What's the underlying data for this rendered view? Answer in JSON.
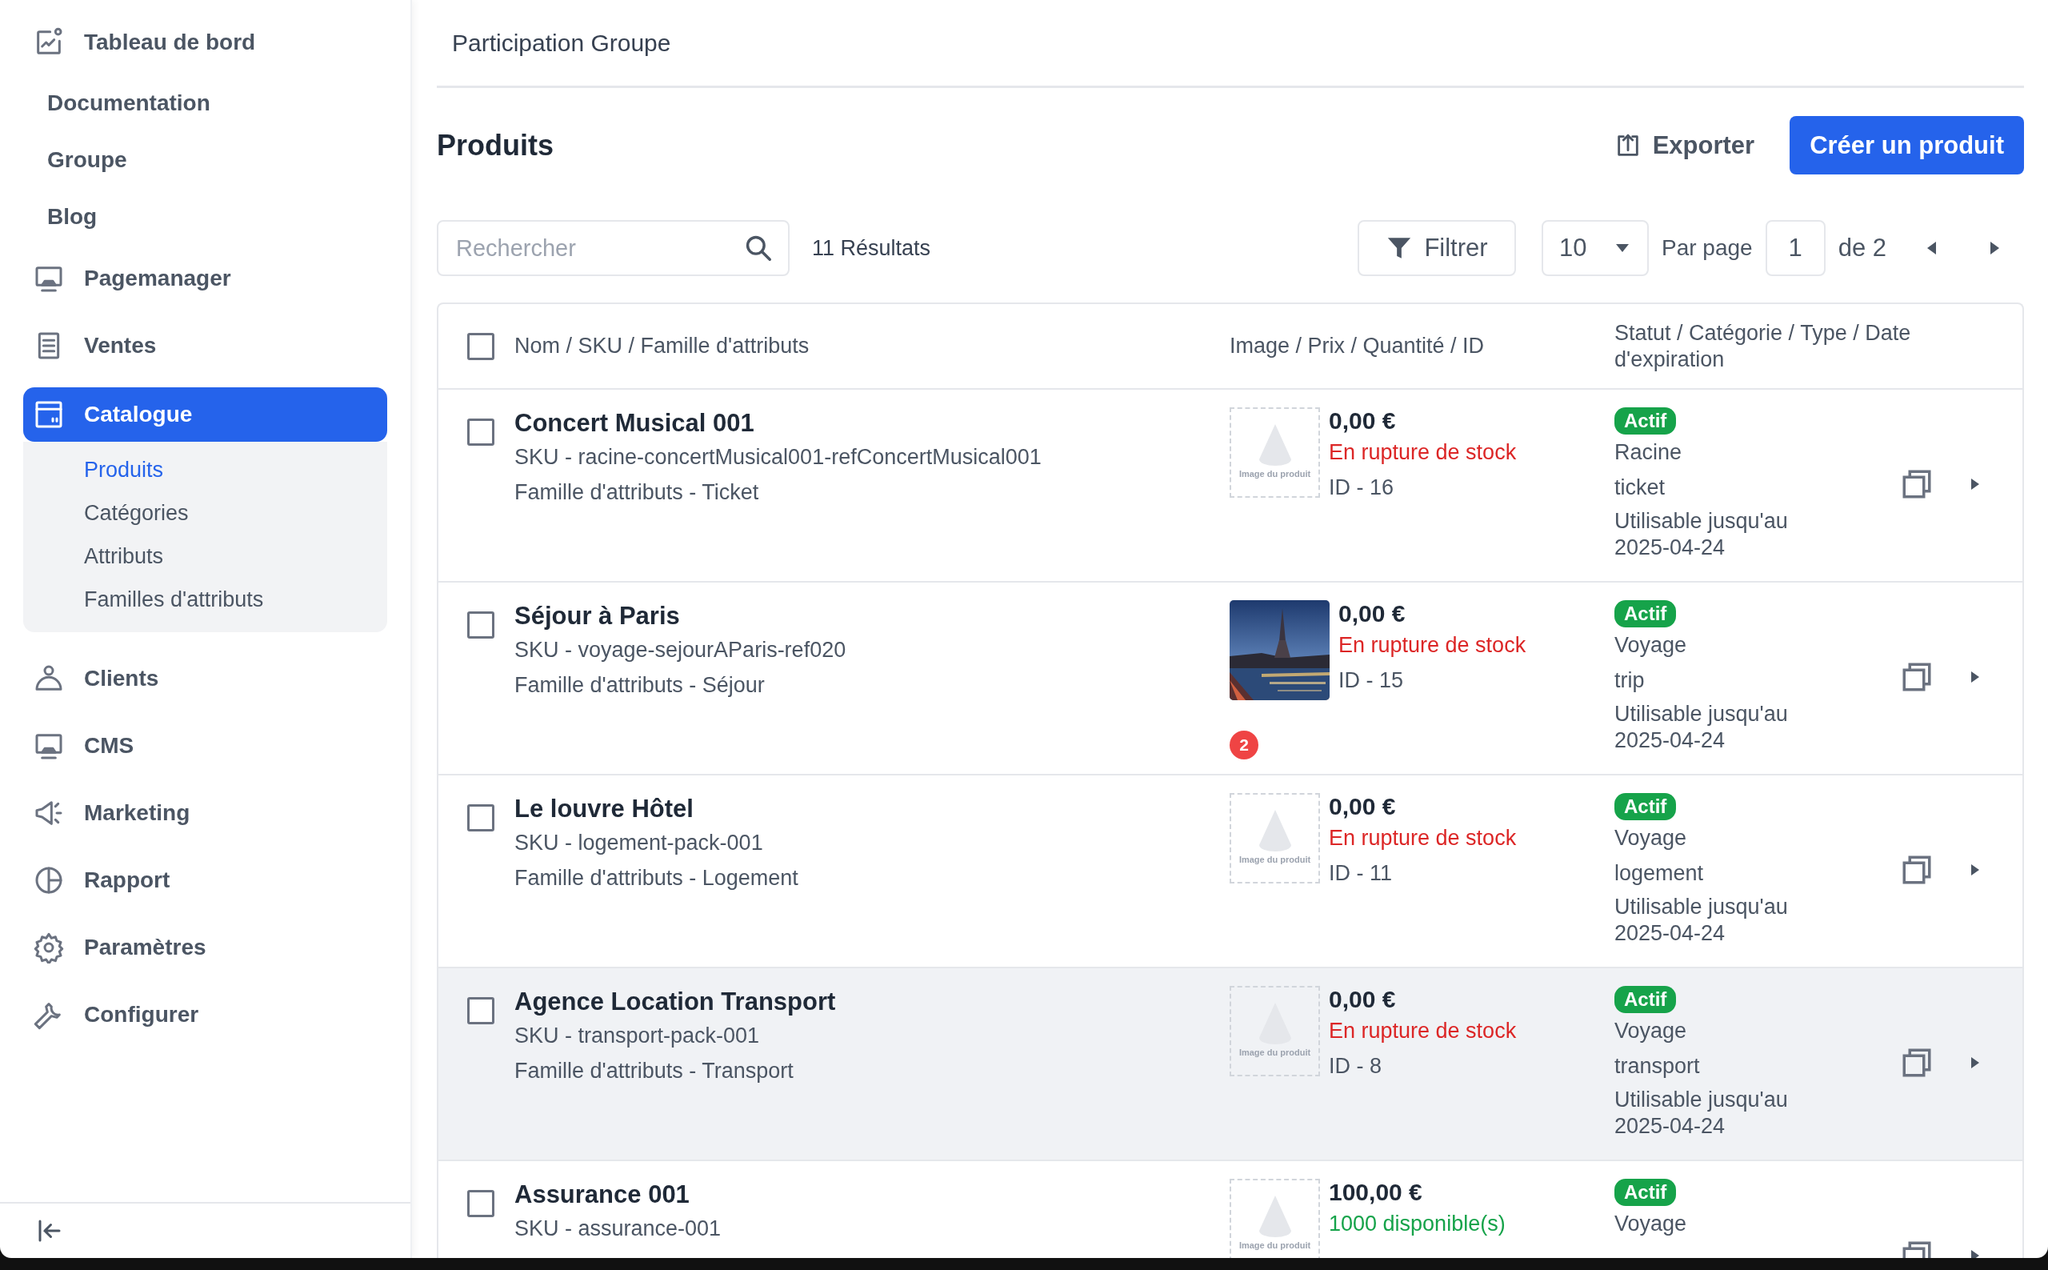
{
  "sidebar": {
    "items": [
      {
        "label": "Tableau de bord",
        "kind": "icon",
        "selected": false
      },
      {
        "label": "Documentation",
        "kind": "plain",
        "selected": false
      },
      {
        "label": "Groupe",
        "kind": "plain",
        "selected": false
      },
      {
        "label": "Blog",
        "kind": "plain",
        "selected": false
      },
      {
        "label": "Pagemanager",
        "kind": "icon",
        "selected": false
      },
      {
        "label": "Ventes",
        "kind": "icon",
        "selected": false
      },
      {
        "label": "Catalogue",
        "kind": "icon",
        "selected": true,
        "expanded": true,
        "children": [
          {
            "label": "Produits",
            "selected": true
          },
          {
            "label": "Catégories",
            "selected": false
          },
          {
            "label": "Attributs",
            "selected": false
          },
          {
            "label": "Familles d'attributs",
            "selected": false
          }
        ]
      },
      {
        "label": "Clients",
        "kind": "icon",
        "selected": false
      },
      {
        "label": "CMS",
        "kind": "icon",
        "selected": false
      },
      {
        "label": "Marketing",
        "kind": "icon",
        "selected": false
      },
      {
        "label": "Rapport",
        "kind": "icon",
        "selected": false
      },
      {
        "label": "Paramètres",
        "kind": "icon",
        "selected": false
      },
      {
        "label": "Configurer",
        "kind": "icon",
        "selected": false
      }
    ]
  },
  "header": {
    "title": "Participation Groupe"
  },
  "page": {
    "title": "Produits",
    "export_button": "Exporter",
    "create_button": "Créer un produit"
  },
  "toolbar": {
    "search": {
      "placeholder": "Rechercher"
    },
    "results": "11 Résultats",
    "filter_button": "Filtrer",
    "per_page_value": "10",
    "per_page_label": "Par page",
    "page_value": "1",
    "page_total": "de 2"
  },
  "table": {
    "select_all_checked": false,
    "columns": [
      "Nom / SKU / Famille d'attributs",
      "Image / Prix / Quantité / ID",
      "Statut / Catégorie / Type / Date d'expiration"
    ],
    "rows": [
      {
        "selected": false,
        "hovered": false,
        "name": "Concert Musical 001",
        "sku": "SKU - racine-concertMusical001-refConcertMusical001",
        "family": "Famille d'attributs - Ticket",
        "image": {
          "kind": "placeholder",
          "label": "Image du produit"
        },
        "price": "0,00 €",
        "stock": "En rupture de stock",
        "in_stock": false,
        "id": "ID - 16",
        "status": "Actif",
        "category": "Racine",
        "type": "ticket",
        "expiry": "Utilisable jusqu'au 2025-04-24"
      },
      {
        "selected": false,
        "hovered": false,
        "name": "Séjour à Paris",
        "sku": "SKU - voyage-sejourAParis-ref020",
        "family": "Famille d'attributs - Séjour",
        "image": {
          "kind": "picture",
          "count": "2"
        },
        "price": "0,00 €",
        "stock": "En rupture de stock",
        "in_stock": false,
        "id": "ID - 15",
        "status": "Actif",
        "category": "Voyage",
        "type": "trip",
        "expiry": "Utilisable jusqu'au 2025-04-24"
      },
      {
        "selected": false,
        "hovered": false,
        "name": "Le louvre Hôtel",
        "sku": "SKU - logement-pack-001",
        "family": "Famille d'attributs - Logement",
        "image": {
          "kind": "placeholder",
          "label": "Image du produit"
        },
        "price": "0,00 €",
        "stock": "En rupture de stock",
        "in_stock": false,
        "id": "ID - 11",
        "status": "Actif",
        "category": "Voyage",
        "type": "logement",
        "expiry": "Utilisable jusqu'au 2025-04-24"
      },
      {
        "selected": false,
        "hovered": true,
        "name": "Agence Location Transport",
        "sku": "SKU - transport-pack-001",
        "family": "Famille d'attributs - Transport",
        "image": {
          "kind": "placeholder",
          "label": "Image du produit"
        },
        "price": "0,00 €",
        "stock": "En rupture de stock",
        "in_stock": false,
        "id": "ID - 8",
        "status": "Actif",
        "category": "Voyage",
        "type": "transport",
        "expiry": "Utilisable jusqu'au 2025-04-24"
      },
      {
        "selected": false,
        "hovered": false,
        "name": "Assurance 001",
        "sku": "SKU - assurance-001",
        "image": {
          "kind": "placeholder",
          "label": "Image du produit"
        },
        "price": "100,00 €",
        "stock": "1000 disponible(s)",
        "in_stock": true,
        "status": "Actif",
        "category": "Voyage"
      }
    ]
  }
}
